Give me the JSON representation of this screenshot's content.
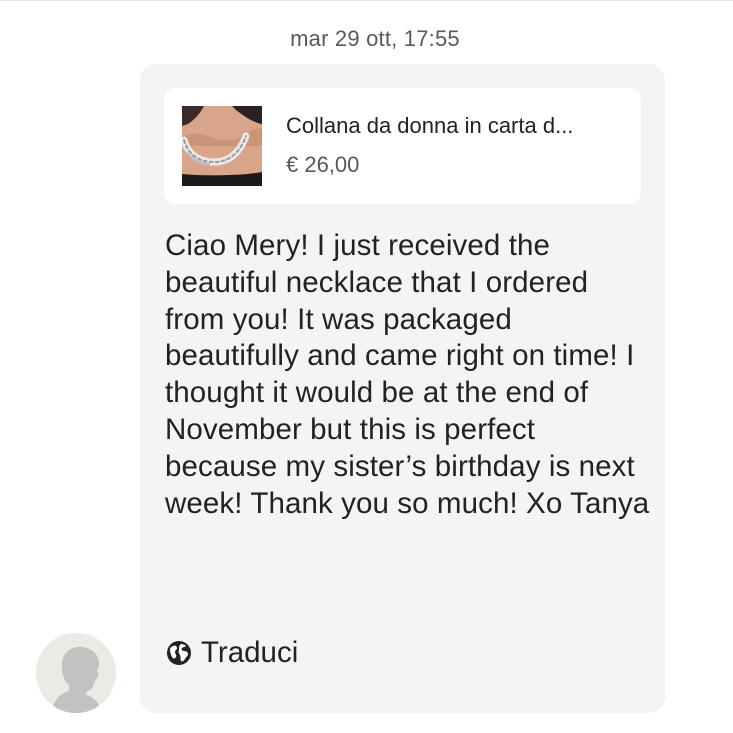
{
  "timestamp": "mar 29 ott, 17:55",
  "listing": {
    "title": "Collana da donna in carta d...",
    "price": "€ 26,00",
    "thumbnail_icon": "necklace-photo"
  },
  "message": {
    "text": "Ciao Mery! I just received the beautiful necklace that I ordered from you! It was packaged beautifully and came right on time! I thought it would be at the end of November but this is perfect because my sister’s birthday is next week! Thank you so much! Xo Tanya"
  },
  "translate": {
    "label": "Traduci",
    "icon": "globe-icon"
  },
  "avatar": {
    "icon": "default-user-silhouette"
  },
  "colors": {
    "bubble_background": "#f4f4f4",
    "card_background": "#ffffff",
    "primary_text": "#222222",
    "secondary_text": "#595959"
  }
}
